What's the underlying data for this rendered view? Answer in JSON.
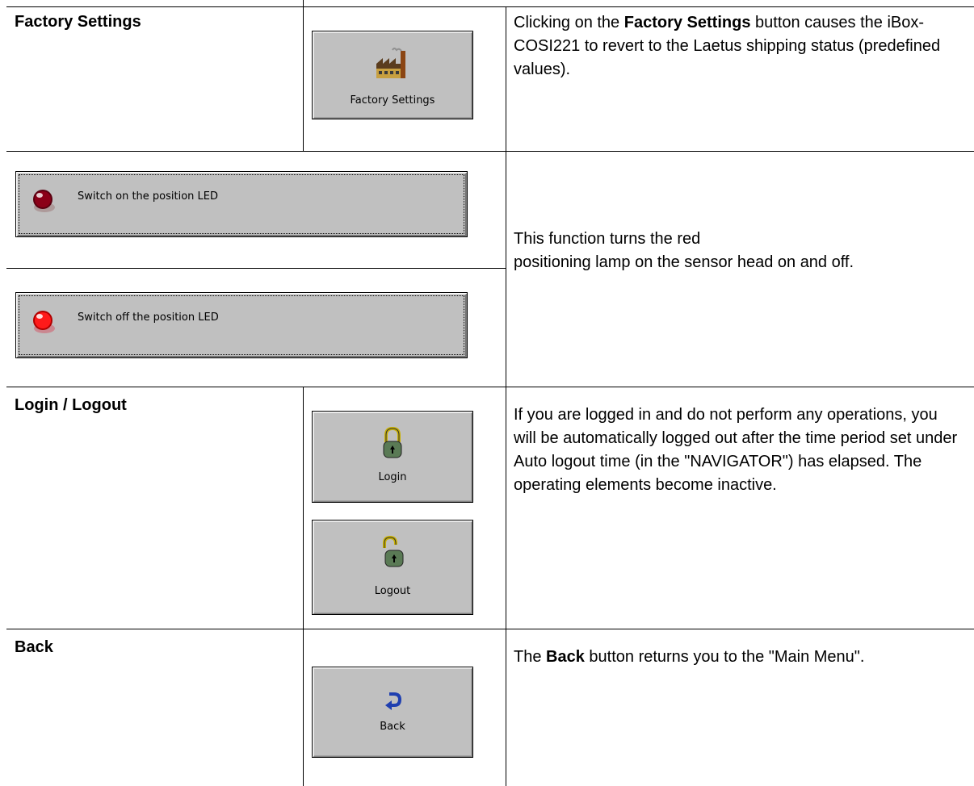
{
  "rows": {
    "factory": {
      "label": "Factory Settings",
      "button_label": "Factory Settings",
      "desc_pre": "Clicking on the ",
      "desc_bold": "Factory Settings",
      "desc_post": " button causes the iBox-COSI221 to revert to the Laetus shipping status (predefined values)."
    },
    "led": {
      "on_button_label": "Switch on the position LED",
      "off_button_label": "Switch off the position LED",
      "desc_line1": "This function turns the red",
      "desc_line2": "positioning lamp on the sensor head on and off."
    },
    "login": {
      "label": "Login / Logout",
      "login_button_label": "Login",
      "logout_button_label": "Logout",
      "desc": "If you are logged in and do not perform any operations, you will be automatically logged out after the time period set under Auto logout time (in the \"NAVIGATOR\") has elapsed. The operating elements become inactive."
    },
    "back": {
      "label": "Back",
      "button_label": "Back",
      "desc_pre": "The ",
      "desc_bold": "Back",
      "desc_post": " button returns you to the \"Main Menu\"."
    }
  },
  "icons": {
    "factory": "factory-icon",
    "led_on": "red-led-dark-icon",
    "led_off": "red-led-bright-icon",
    "login": "padlock-closed-icon",
    "logout": "padlock-open-icon",
    "back": "back-arrow-icon"
  },
  "colors": {
    "button_face": "#c0c0c0",
    "led_dark": "#8b0000",
    "led_bright": "#ff2020",
    "back_arrow": "#1f3fb0"
  }
}
